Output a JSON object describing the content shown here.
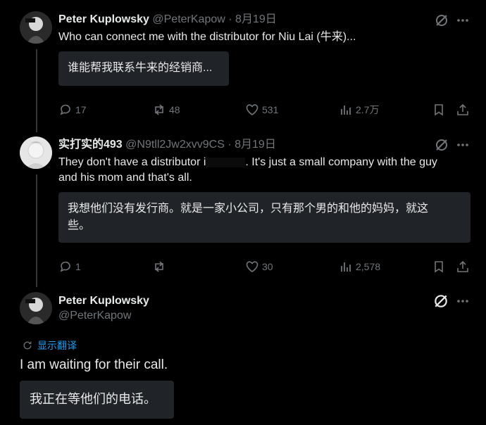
{
  "tweets": [
    {
      "name": "Peter Kuplowsky",
      "handle": "@PeterKapow",
      "date": "8月19日",
      "text": "Who can connect me with the distributor for Niu Lai (牛来)...",
      "translation": "谁能帮我联系牛来的经销商...",
      "replies": "17",
      "retweets": "48",
      "likes": "531",
      "views": "2.7万"
    },
    {
      "name": "实打实的493",
      "handle": "@N9tll2Jw2xvv9CS",
      "date": "8月19日",
      "text_line1": "They don't have a distributor i",
      "text_line1b": ". It's just a small company with the guy",
      "text_line2": "and his mom and that's all.",
      "translation_line1": "我想他们没有发行商。就是一家小公司，只有那个男的和他的妈妈，就这",
      "translation_line2": "些。",
      "replies": "1",
      "retweets": "",
      "likes": "30",
      "views": "2,578"
    }
  ],
  "main_tweet": {
    "name": "Peter Kuplowsky",
    "handle": "@PeterKapow",
    "show_translation_label": "显示翻译",
    "text": "I am waiting for their call.",
    "translation": "我正在等他们的电话。"
  },
  "colors": {
    "background": "#000000",
    "text": "#e7e9ea",
    "muted": "#71767b",
    "translation_box": "#202327"
  },
  "icons": [
    "grok-icon",
    "more-icon",
    "reply-icon",
    "retweet-icon",
    "like-icon",
    "views-icon",
    "bookmark-icon",
    "share-icon",
    "translate-icon"
  ]
}
